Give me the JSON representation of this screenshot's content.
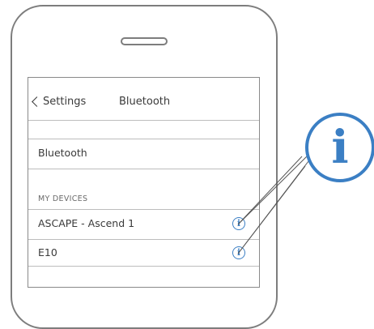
{
  "navbar": {
    "back_label": "Settings",
    "title": "Bluetooth"
  },
  "bluetooth_row": {
    "label": "Bluetooth"
  },
  "my_devices": {
    "header": "MY DEVICES",
    "items": [
      {
        "name": "ASCAPE - Ascend 1",
        "info_icon": "info-icon"
      },
      {
        "name": "E10",
        "info_icon": "info-icon"
      }
    ]
  },
  "callout": {
    "icon": "info-icon",
    "glyph": "i",
    "color": "#3b7fc4"
  },
  "colors": {
    "accent": "#3b7fc4",
    "outline": "#7d7d7d"
  }
}
